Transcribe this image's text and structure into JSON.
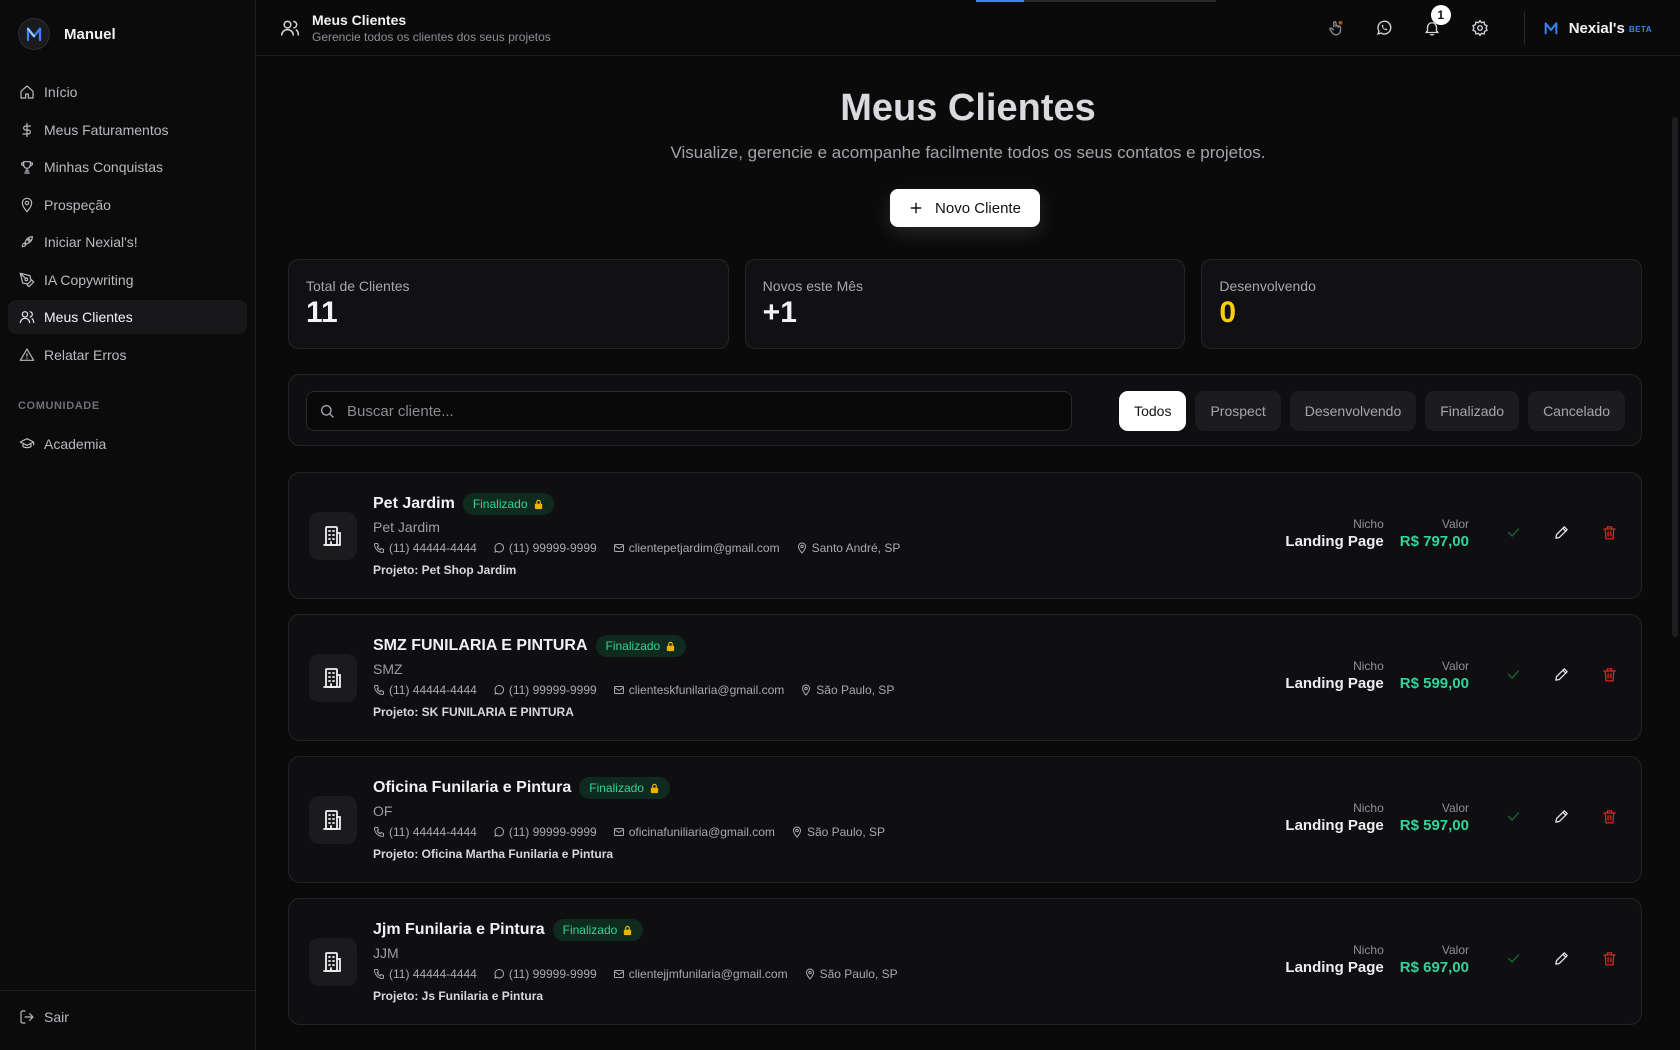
{
  "sidebar": {
    "user_name": "Manuel",
    "items": [
      {
        "label": "Início",
        "icon": "home-icon"
      },
      {
        "label": "Meus Faturamentos",
        "icon": "dollar-icon"
      },
      {
        "label": "Minhas Conquistas",
        "icon": "trophy-icon"
      },
      {
        "label": "Prospeção",
        "icon": "map-pin-icon"
      },
      {
        "label": "Iniciar Nexial's!",
        "icon": "rocket-icon"
      },
      {
        "label": "IA Copywriting",
        "icon": "pen-tool-icon"
      },
      {
        "label": "Meus Clientes",
        "icon": "users-icon",
        "active": true
      },
      {
        "label": "Relatar Erros",
        "icon": "alert-triangle-icon"
      }
    ],
    "section_label": "COMUNIDADE",
    "community_items": [
      {
        "label": "Academia",
        "icon": "graduation-cap-icon"
      }
    ],
    "logout_label": "Sair"
  },
  "header": {
    "title": "Meus Clientes",
    "subtitle": "Gerencie todos os clientes dos seus projetos",
    "notification_count": "1",
    "brand_name": "Nexial's",
    "brand_tag": "BETA",
    "top_progress": 0.2
  },
  "page": {
    "title": "Meus Clientes",
    "subtitle": "Visualize, gerencie e acompanhe facilmente todos os seus contatos e projetos.",
    "new_button": "Novo Cliente"
  },
  "stats": [
    {
      "label": "Total de Clientes",
      "value": "11"
    },
    {
      "label": "Novos este Mês",
      "value": "+1"
    },
    {
      "label": "Desenvolvendo",
      "value": "0"
    }
  ],
  "search": {
    "placeholder": "Buscar cliente..."
  },
  "filters": [
    "Todos",
    "Prospect",
    "Desenvolvendo",
    "Finalizado",
    "Cancelado"
  ],
  "active_filter": "Todos",
  "labels": {
    "niche": "Nicho",
    "value": "Valor",
    "project_prefix": "Projeto: "
  },
  "clients": [
    {
      "name": "Pet Jardim",
      "status": "Finalizado",
      "short": "Pet Jardim",
      "phone": "(11) 44444-4444",
      "whatsapp": "(11) 99999-9999",
      "email": "clientepetjardim@gmail.com",
      "location": "Santo André, SP",
      "project": "Projeto: Pet Shop Jardim",
      "niche": "Landing Page",
      "value": "R$ 797,00"
    },
    {
      "name": "SMZ FUNILARIA E PINTURA",
      "status": "Finalizado",
      "short": "SMZ",
      "phone": "(11) 44444-4444",
      "whatsapp": "(11) 99999-9999",
      "email": "clienteskfunilaria@gmail.com",
      "location": "São Paulo, SP",
      "project": "Projeto: SK FUNILARIA E PINTURA",
      "niche": "Landing Page",
      "value": "R$ 599,00"
    },
    {
      "name": "Oficina Funilaria e Pintura",
      "status": "Finalizado",
      "short": "OF",
      "phone": "(11) 44444-4444",
      "whatsapp": "(11) 99999-9999",
      "email": "oficinafuniliaria@gmail.com",
      "location": "São Paulo, SP",
      "project": "Projeto: Oficina Martha Funilaria e Pintura",
      "niche": "Landing Page",
      "value": "R$ 597,00"
    },
    {
      "name": "Jjm Funilaria e Pintura",
      "status": "Finalizado",
      "short": "JJM",
      "phone": "(11) 44444-4444",
      "whatsapp": "(11) 99999-9999",
      "email": "clientejjmfunilaria@gmail.com",
      "location": "São Paulo, SP",
      "project": "Projeto: Js Funilaria e Pintura",
      "niche": "Landing Page",
      "value": "R$ 697,00"
    }
  ],
  "colors": {
    "accent": "#3b82f6",
    "success": "#34d399",
    "warning": "#facc15",
    "danger": "#dc2626"
  }
}
